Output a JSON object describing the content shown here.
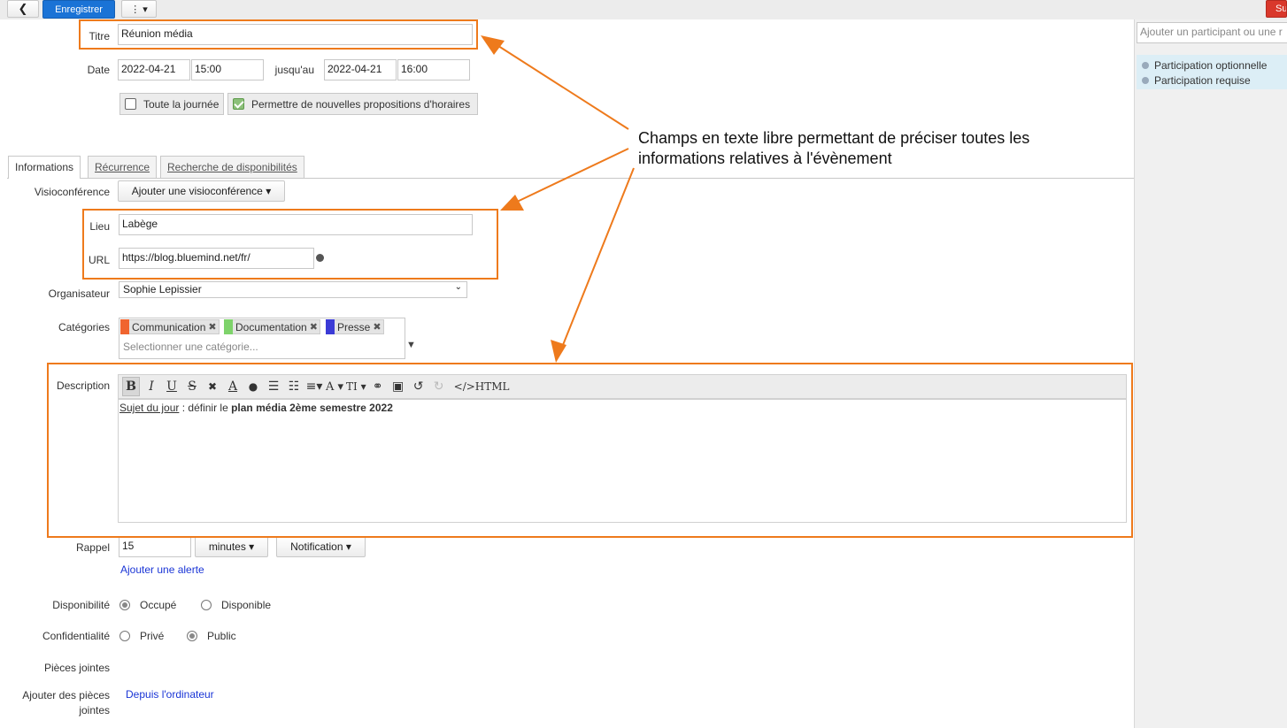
{
  "toolbar": {
    "back_label": "❮",
    "save_label": "Enregistrer",
    "more_label": "⋮ ▾",
    "send_label": "Su"
  },
  "form": {
    "title_label": "Titre",
    "title_value": "Réunion média",
    "date_label": "Date",
    "start_date": "2022-04-21",
    "start_time": "15:00",
    "until_label": "jusqu'au",
    "end_date": "2022-04-21",
    "end_time": "16:00",
    "all_day_label": "Toute la journée",
    "proposals_label": "Permettre de nouvelles propositions d'horaires"
  },
  "tabs": [
    {
      "label": "Informations"
    },
    {
      "label": "Récurrence"
    },
    {
      "label": "Recherche de disponibilités"
    }
  ],
  "info": {
    "visio_label": "Visioconférence",
    "visio_button": "Ajouter une visioconférence ▾",
    "location_label": "Lieu",
    "location_value": "Labège",
    "url_label": "URL",
    "url_value": "https://blog.bluemind.net/fr/",
    "organizer_label": "Organisateur",
    "organizer_value": "Sophie Lepissier",
    "categories_label": "Catégories",
    "categories": [
      {
        "label": "Communication",
        "color": "#f0642f"
      },
      {
        "label": "Documentation",
        "color": "#7ed36b"
      },
      {
        "label": "Presse",
        "color": "#3b3bd6"
      }
    ],
    "category_placeholder": "Selectionner une catégorie...",
    "description_label": "Description",
    "description_part1": "Sujet du jour",
    "description_part2": " : définir le ",
    "description_part3": "plan média 2ème semestre 2022",
    "rte_html_label": "</>HTML",
    "reminder_label": "Rappel",
    "reminder_value": "15",
    "reminder_unit": "minutes ▾",
    "reminder_type": "Notification ▾",
    "add_alert": "Ajouter une alerte",
    "availability_label": "Disponibilité",
    "busy_label": "Occupé",
    "free_label": "Disponible",
    "privacy_label": "Confidentialité",
    "private_label": "Privé",
    "public_label": "Public",
    "attachments_label": "Pièces jointes",
    "add_attachments_label_1": "Ajouter des pièces",
    "add_attachments_label_2": "jointes",
    "from_computer": "Depuis l'ordinateur"
  },
  "sidebar": {
    "attendee_placeholder": "Ajouter un participant ou une r",
    "optional_label": "Participation optionnelle",
    "required_label": "Participation requise"
  },
  "annotation": {
    "line1": "Champs en texte libre permettant de préciser toutes les",
    "line2": "informations relatives à l'évènement",
    "color": "#ee7a1c"
  }
}
